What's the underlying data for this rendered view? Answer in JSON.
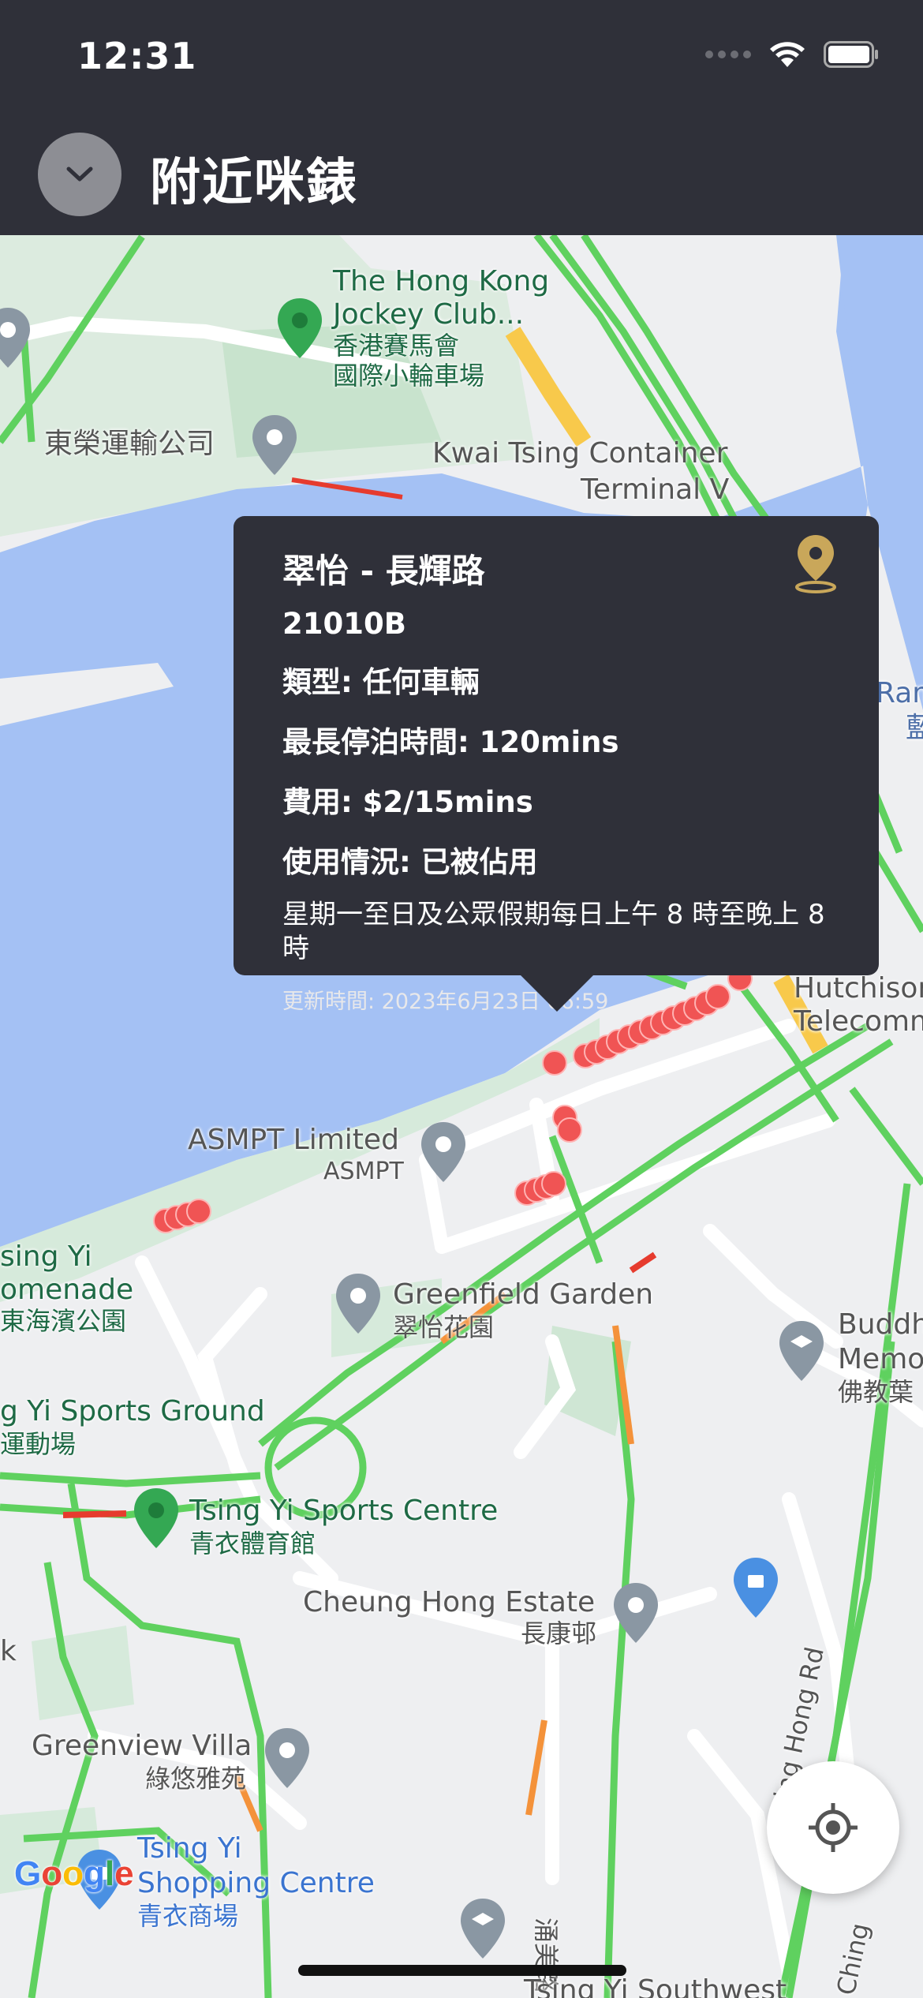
{
  "status_bar": {
    "time": "12:31"
  },
  "header": {
    "title": "附近咪錶",
    "back_icon": "chevron-down-icon"
  },
  "popup": {
    "title": "翠怡 - 長輝路",
    "meter_id": "21010B",
    "vehicle_type": "類型: 任何車輛",
    "max_parking": "最長停泊時間: 120mins",
    "fee": "費用: $2/15mins",
    "status": "使用情況: 已被佔用",
    "hours": "星期一至日及公眾假期每日上午 8 時至晚上 8 時",
    "updated": "更新時間: 2023年6月23日 06:59",
    "accent_color": "#c9a75a"
  },
  "map": {
    "labels": {
      "jockey_en1": "The Hong Kong",
      "jockey_en2": "Jockey Club...",
      "jockey_zh1": "香港賽馬會",
      "jockey_zh2": "國際小輪車場",
      "tungwing": "東榮運輸公司",
      "kwaitsing1": "Kwai Tsing Container",
      "kwaitsing2": "Terminal V",
      "hutchison1": "Hutchison",
      "hutchison2": "Telecomm",
      "ram": "Ram",
      "ram_zh": "藍",
      "asmpt_en": "ASMPT Limited",
      "asmpt_sub": "ASMPT",
      "tsingyi_prom1": "sing Yi",
      "tsingyi_prom2": "omenade",
      "tsingyi_prom3": "東海濱公園",
      "greenfield_en": "Greenfield Garden",
      "greenfield_zh": "翠怡花園",
      "buddh1": "Buddh",
      "buddh2": "Memo",
      "buddh3": "佛教葉",
      "sportsground1": "g Yi Sports Ground",
      "sportsground2": "運動場",
      "sportscentre_en": "Tsing Yi Sports Centre",
      "sportscentre_zh": "青衣體育館",
      "cheunghong_en": "Cheung Hong Estate",
      "cheunghong_zh": "長康邨",
      "greenview_en": "Greenview Villa",
      "greenview_zh": "綠悠雅苑",
      "k": "k",
      "shopping1": "Tsing Yi",
      "shopping2": "Shopping Centre",
      "shopping3": "青衣商場",
      "chinghong": "Ching Hong Rd",
      "chinghong2": "Ching",
      "yungmei": "涌美路",
      "southwest": "Tsing Yi Southwest"
    },
    "google_logo": [
      "G",
      "o",
      "o",
      "g",
      "l",
      "e"
    ],
    "meter_marker_color": "#f05454"
  },
  "locate_icon": "my-location-icon"
}
